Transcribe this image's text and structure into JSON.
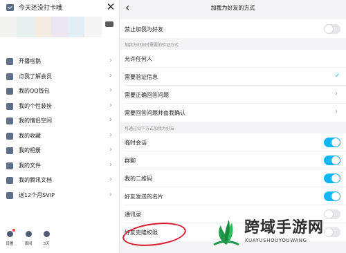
{
  "drawer": {
    "sign_in_label": "今天还没打卡哦",
    "close_glyph": "✕",
    "menu_items": [
      {
        "label": "开播啦鹅",
        "icon": "live-icon"
      },
      {
        "label": "点我了解会员",
        "icon": "vip-icon"
      },
      {
        "label": "我的QQ钱包",
        "icon": "wallet-icon"
      },
      {
        "label": "我的个性装扮",
        "icon": "outfit-icon"
      },
      {
        "label": "我的情侣空间",
        "icon": "couple-icon"
      },
      {
        "label": "我的收藏",
        "icon": "favorite-icon"
      },
      {
        "label": "我的相册",
        "icon": "album-icon"
      },
      {
        "label": "我的文件",
        "icon": "folder-icon"
      },
      {
        "label": "我的腾讯文档",
        "icon": "docs-icon"
      },
      {
        "label": "送12个月SVIP",
        "icon": "gift-icon"
      }
    ],
    "footer": [
      {
        "label": "设置",
        "icon": "settings-icon"
      },
      {
        "label": "夜间",
        "icon": "night-icon"
      },
      {
        "label": "3天",
        "icon": "weather-icon"
      }
    ]
  },
  "settings": {
    "back_glyph": "‹",
    "title": "加我为好友的方式",
    "forbid_label": "禁止加我为好友",
    "forbid_on": false,
    "verify_section_label": "加我为好友时需要的验证方式",
    "verify_options": [
      {
        "label": "允许任何人",
        "selected": false,
        "chevron": false
      },
      {
        "label": "需要验证信息",
        "selected": true,
        "chevron": false
      },
      {
        "label": "需要正确回答问题",
        "selected": false,
        "chevron": true
      },
      {
        "label": "需要回答问题并由我确认",
        "selected": false,
        "chevron": true
      }
    ],
    "methods_section_label": "可通过以下方式加我为好友",
    "methods": [
      {
        "label": "临时会话",
        "on": true
      },
      {
        "label": "群聊",
        "on": true
      },
      {
        "label": "我的二维码",
        "on": true
      },
      {
        "label": "好友发送的名片",
        "on": true
      },
      {
        "label": "通讯录",
        "on": false
      },
      {
        "label": "好友克隆权限",
        "on": false
      }
    ],
    "check_glyph": "✓",
    "chevron_glyph": "›"
  },
  "watermark": {
    "title": "跨域手游网",
    "subtitle": "KUAYUSHOUYOUWANG"
  },
  "colors": {
    "accent": "#12b7f5",
    "highlight_circle": "#d7192b"
  }
}
